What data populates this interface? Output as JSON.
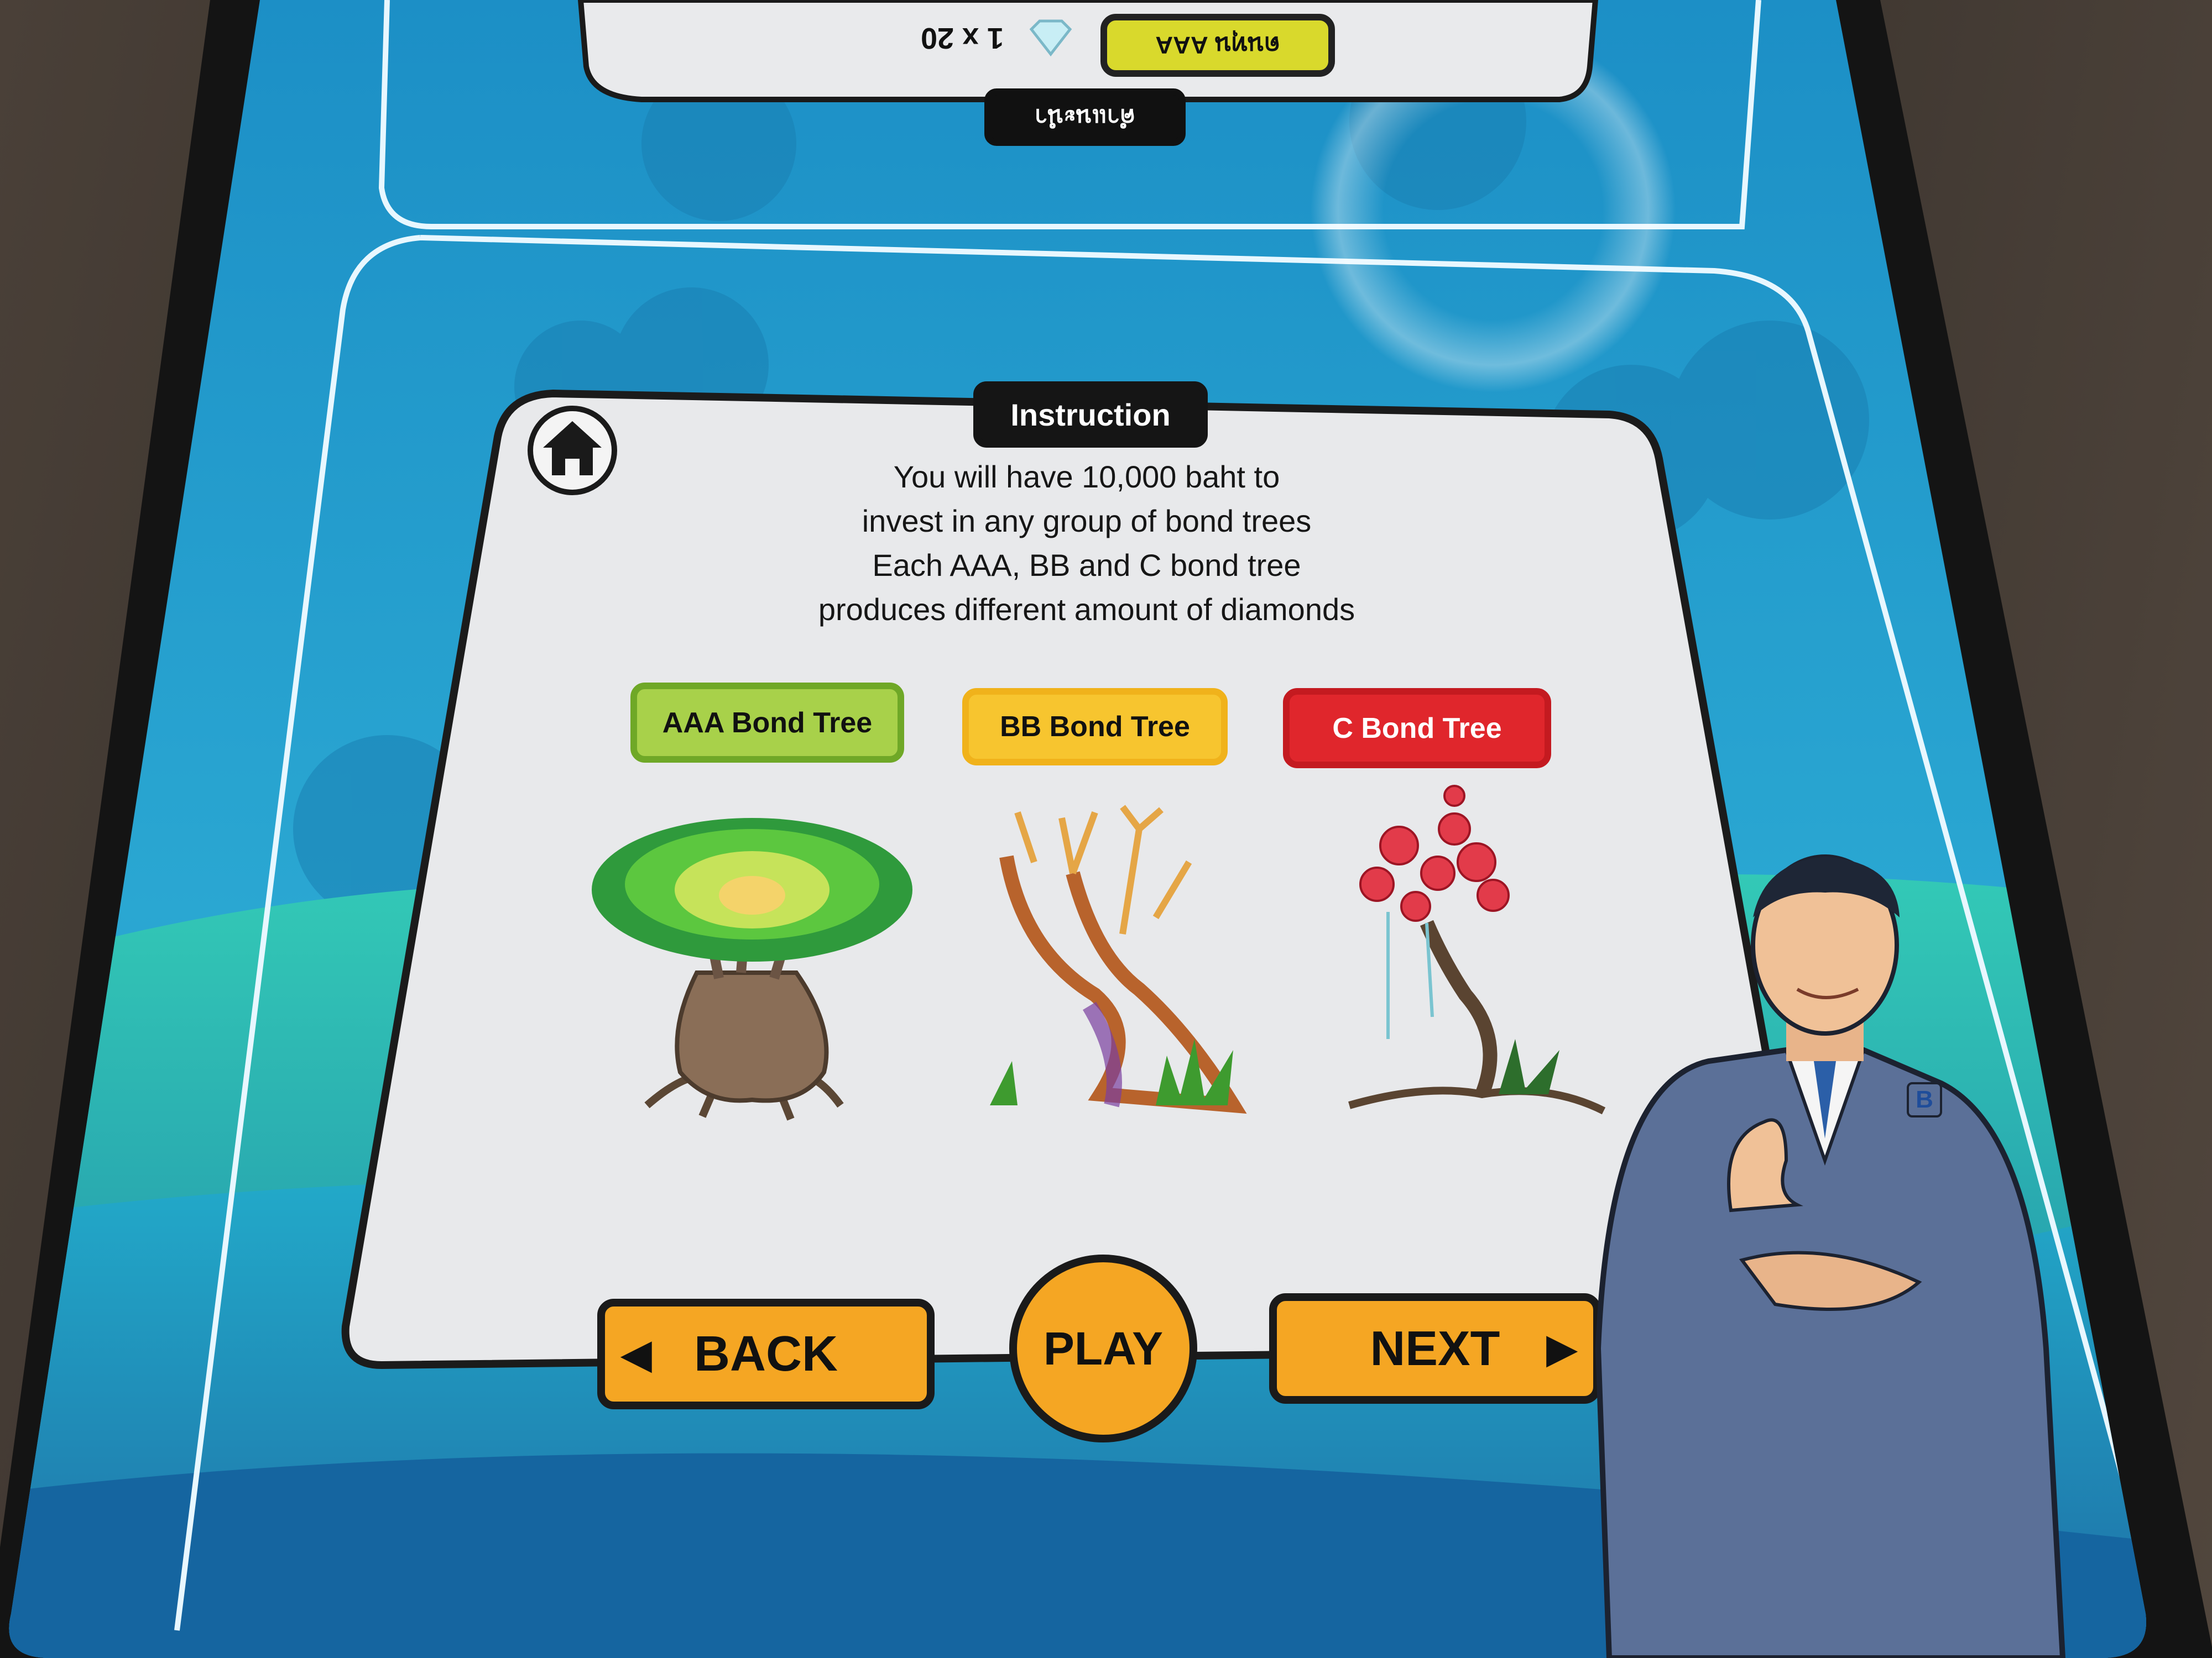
{
  "top_panel": {
    "bond_label": "ดนทุน AAA",
    "reward": "1 x 20",
    "tab_label": "คำแนะนำ"
  },
  "instruction": {
    "title": "Instruction",
    "lines": [
      "You will have 10,000 baht to",
      "invest in any group of bond trees",
      "Each AAA, BB and C bond tree",
      "produces different amount of diamonds"
    ]
  },
  "trees": [
    {
      "label": "AAA Bond Tree",
      "color": "#a8d14a"
    },
    {
      "label": "BB Bond Tree",
      "color": "#f7c52f"
    },
    {
      "label": "C Bond Tree",
      "color": "#e0262c"
    }
  ],
  "nav": {
    "back": "BACK",
    "play": "PLAY",
    "next": "NEXT"
  },
  "mascot": {
    "badge": "B"
  },
  "icons": [
    "home-icon",
    "diamond-icon",
    "back-arrow-icon",
    "next-arrow-icon"
  ]
}
